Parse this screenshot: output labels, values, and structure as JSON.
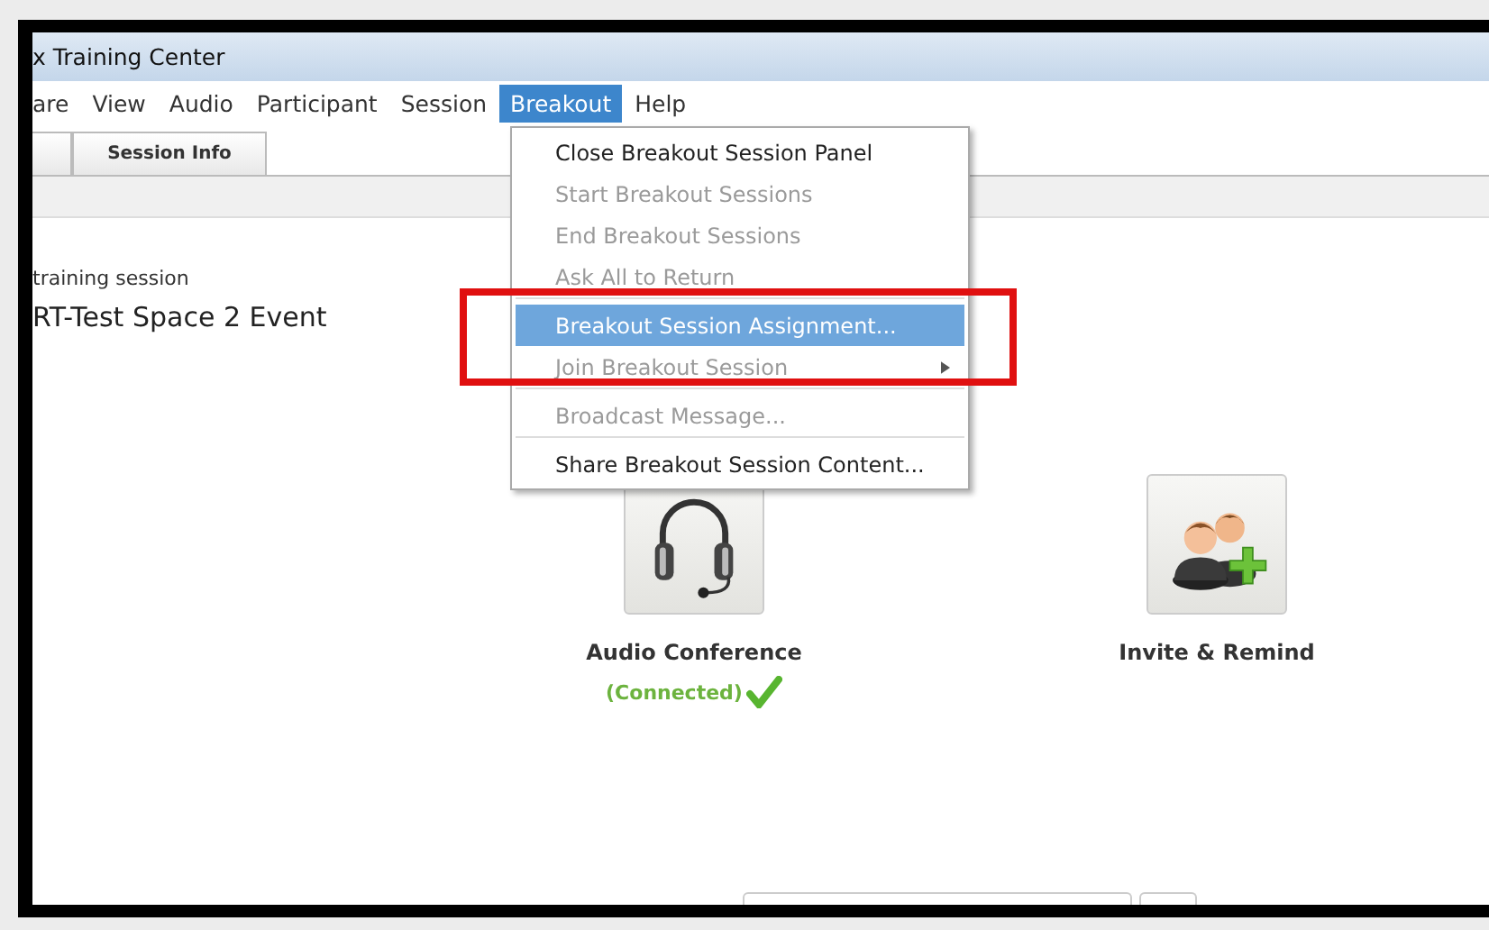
{
  "window": {
    "title": "x Training Center"
  },
  "menu_bar": [
    {
      "label": "are",
      "selected": false
    },
    {
      "label": "View",
      "selected": false
    },
    {
      "label": "Audio",
      "selected": false
    },
    {
      "label": "Participant",
      "selected": false
    },
    {
      "label": "Session",
      "selected": false
    },
    {
      "label": "Breakout",
      "selected": true
    },
    {
      "label": "Help",
      "selected": false
    }
  ],
  "dropdown": [
    {
      "label": "Close Breakout Session Panel",
      "disabled": false,
      "selected": false,
      "separator_after": false,
      "submenu": false
    },
    {
      "label": "Start Breakout Sessions",
      "disabled": true,
      "selected": false,
      "separator_after": false,
      "submenu": false
    },
    {
      "label": "End Breakout Sessions",
      "disabled": true,
      "selected": false,
      "separator_after": false,
      "submenu": false
    },
    {
      "label": "Ask All to Return",
      "disabled": true,
      "selected": false,
      "separator_after": true,
      "submenu": false
    },
    {
      "label": "Breakout Session Assignment...",
      "disabled": false,
      "selected": true,
      "separator_after": false,
      "submenu": false
    },
    {
      "label": "Join Breakout Session",
      "disabled": true,
      "selected": false,
      "separator_after": true,
      "submenu": true
    },
    {
      "label": "Broadcast Message...",
      "disabled": true,
      "selected": false,
      "separator_after": true,
      "submenu": false
    },
    {
      "label": "Share Breakout Session Content...",
      "disabled": false,
      "selected": false,
      "separator_after": false,
      "submenu": false
    }
  ],
  "tabs": [
    {
      "label": "Session Info",
      "selected": false
    }
  ],
  "session": {
    "subtitle": "training session",
    "title": "RT-Test Space 2 Event"
  },
  "actions": [
    {
      "kind": "headset",
      "label": "Audio Conference",
      "status": "(Connected)"
    },
    {
      "kind": "invite",
      "label": "Invite & Remind"
    }
  ]
}
